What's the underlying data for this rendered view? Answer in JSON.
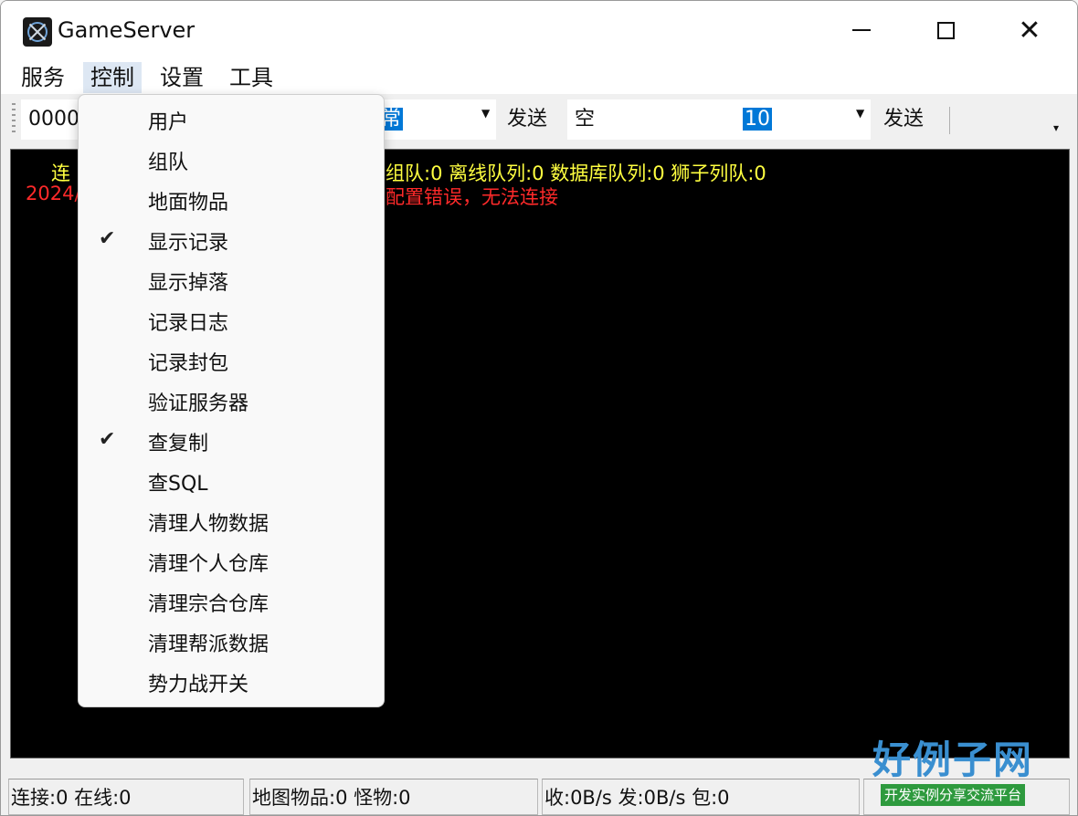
{
  "window": {
    "title": "GameServer"
  },
  "menubar": [
    {
      "label": "服务"
    },
    {
      "label": "控制"
    },
    {
      "label": "设置"
    },
    {
      "label": "工具"
    }
  ],
  "toolbar": {
    "field1_value": "0000",
    "field2_value": "常",
    "send1_label": "发送",
    "field3_value": "空",
    "field4_value": "10",
    "send2_label": "发送"
  },
  "console": {
    "line1_prefix": "连",
    "line1_rest": "组队:0 离线队列:0 数据库队列:0 狮子列队:0",
    "line2_prefix": "2024/",
    "line2_rest": "配置错误，无法连接",
    "colors": {
      "info": "#ffff40",
      "error": "#ff2a2a",
      "background": "#000000"
    }
  },
  "control_menu": {
    "items": [
      {
        "label": "用户",
        "checked": false
      },
      {
        "label": "组队",
        "checked": false
      },
      {
        "label": "地面物品",
        "checked": false
      },
      {
        "label": "显示记录",
        "checked": true
      },
      {
        "label": "显示掉落",
        "checked": false
      },
      {
        "label": "记录日志",
        "checked": false
      },
      {
        "label": "记录封包",
        "checked": false
      },
      {
        "label": "验证服务器",
        "checked": false
      },
      {
        "label": "查复制",
        "checked": true
      },
      {
        "label": "查SQL",
        "checked": false
      },
      {
        "label": "清理人物数据",
        "checked": false
      },
      {
        "label": "清理个人仓库",
        "checked": false
      },
      {
        "label": "清理宗合仓库",
        "checked": false
      },
      {
        "label": "清理帮派数据",
        "checked": false
      },
      {
        "label": "势力战开关",
        "checked": false
      }
    ],
    "check_glyph": "✔"
  },
  "statusbar": {
    "connections": "连接:0 在线:0",
    "map": "地图物品:0 怪物:0",
    "traffic": "收:0B/s 发:0B/s 包:0"
  },
  "watermark": {
    "logo": "好例子网",
    "tagline": "开发实例分享交流平台"
  }
}
